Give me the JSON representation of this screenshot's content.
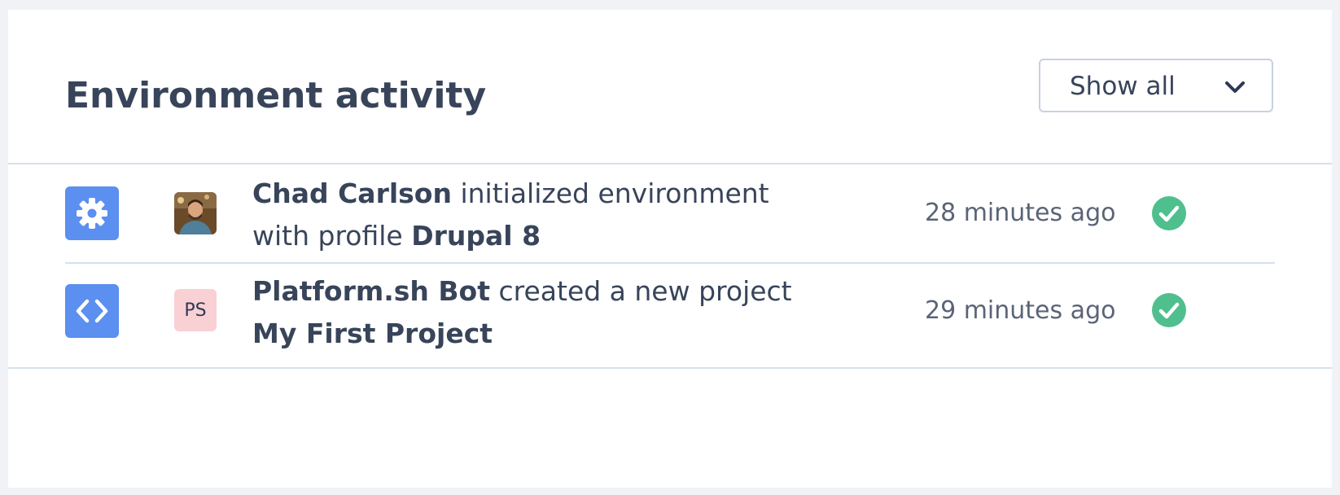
{
  "header": {
    "title": "Environment activity",
    "filter": {
      "selected": "Show all"
    }
  },
  "activities": [
    {
      "type_icon": "gear-icon",
      "avatar": {
        "kind": "photo",
        "initials": ""
      },
      "actor": "Chad Carlson",
      "action": " initialized environment with profile ",
      "target": "Drupal 8",
      "time": "28 minutes ago",
      "status": "success"
    },
    {
      "type_icon": "code-icon",
      "avatar": {
        "kind": "initials",
        "initials": "PS"
      },
      "actor": "Platform.sh Bot",
      "action": " created a new project ",
      "target": "My First Project",
      "time": "29 minutes ago",
      "status": "success"
    }
  ],
  "colors": {
    "accent": "#5b8ff0",
    "success": "#4fbf8d",
    "text": "#38445a",
    "muted": "#5b6477",
    "divider": "#d6e1ec",
    "initials_bg": "#f9d0d4"
  }
}
